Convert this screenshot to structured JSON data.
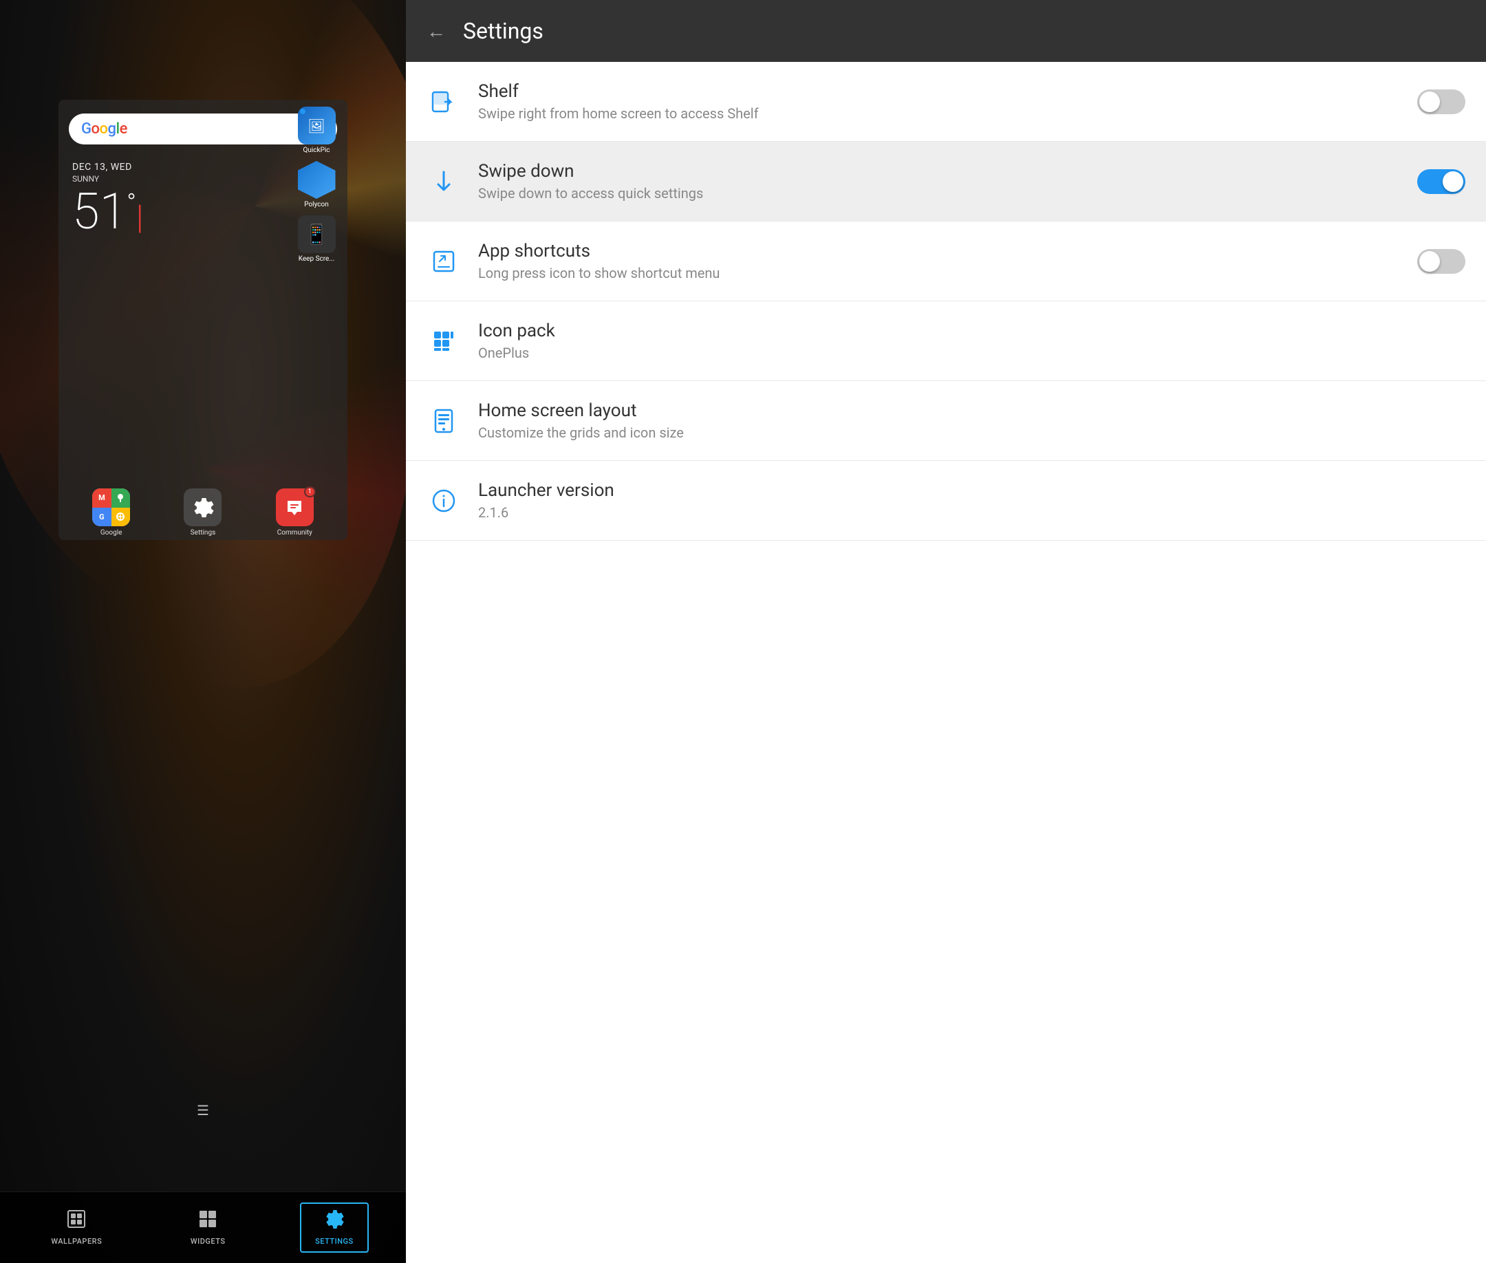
{
  "left": {
    "search": {
      "logo": "Google",
      "mic_label": "mic"
    },
    "date": "DEC 13, WED",
    "weather": "SUNNY",
    "temperature": "51",
    "temp_unit": "°",
    "apps": [
      {
        "name": "QuickPic",
        "label": "QuickPi..."
      },
      {
        "name": "Polycon",
        "label": "Polycon"
      },
      {
        "name": "KeepScr",
        "label": "Keep Scre..."
      }
    ],
    "dock": [
      {
        "name": "Google",
        "label": "Google"
      },
      {
        "name": "Settings",
        "label": "Settings"
      },
      {
        "name": "Community",
        "label": "Community",
        "badge": "1"
      }
    ],
    "bottom_buttons": [
      {
        "id": "wallpapers",
        "label": "WALLPAPERS",
        "active": false
      },
      {
        "id": "widgets",
        "label": "WIDGETS",
        "active": false
      },
      {
        "id": "settings",
        "label": "SETTINGS",
        "active": true
      }
    ]
  },
  "right": {
    "header": {
      "back_label": "←",
      "title": "Settings"
    },
    "items": [
      {
        "id": "shelf",
        "icon": "shelf",
        "title": "Shelf",
        "subtitle": "Swipe right from home screen to access Shelf",
        "control": "toggle",
        "toggle_state": "off"
      },
      {
        "id": "swipe-down",
        "icon": "swipe-down",
        "title": "Swipe down",
        "subtitle": "Swipe down to access quick settings",
        "control": "toggle",
        "toggle_state": "on",
        "highlighted": true
      },
      {
        "id": "app-shortcuts",
        "icon": "app-shortcuts",
        "title": "App shortcuts",
        "subtitle": "Long press icon to show shortcut menu",
        "control": "toggle",
        "toggle_state": "off"
      },
      {
        "id": "icon-pack",
        "icon": "icon-pack",
        "title": "Icon pack",
        "subtitle": "OnePlus",
        "control": "none"
      },
      {
        "id": "home-screen-layout",
        "icon": "home-layout",
        "title": "Home screen layout",
        "subtitle": "Customize the grids and icon size",
        "control": "none"
      },
      {
        "id": "launcher-version",
        "icon": "launcher-version",
        "title": "Launcher version",
        "subtitle": "2.1.6",
        "control": "none"
      }
    ]
  }
}
